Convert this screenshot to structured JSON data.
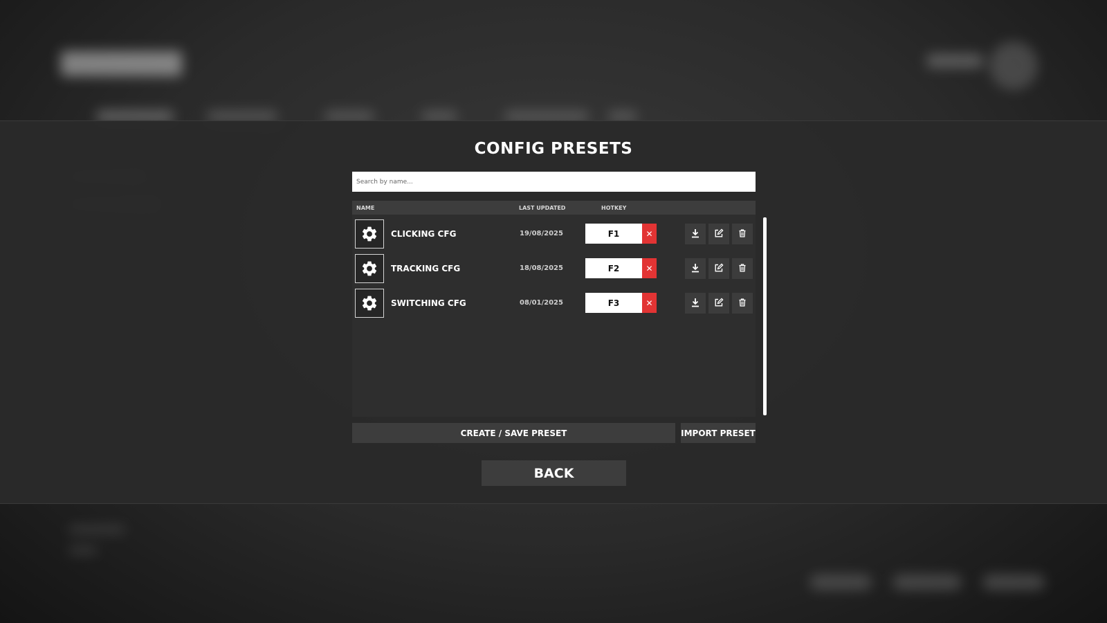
{
  "modal": {
    "title": "CONFIG PRESETS",
    "search_placeholder": "Search by name..."
  },
  "table": {
    "columns": {
      "name": "NAME",
      "last_updated": "LAST UPDATED",
      "hotkey": "HOTKEY"
    },
    "rows": [
      {
        "name": "CLICKING CFG",
        "last_updated": "19/08/2025",
        "hotkey": "F1",
        "icon": "gear-icon"
      },
      {
        "name": "TRACKING CFG",
        "last_updated": "18/08/2025",
        "hotkey": "F2",
        "icon": "gear-icon"
      },
      {
        "name": "SWITCHING CFG",
        "last_updated": "08/01/2025",
        "hotkey": "F3",
        "icon": "gear-icon"
      }
    ],
    "clear_hotkey_glyph": "✕"
  },
  "actions": {
    "create_save": "CREATE / SAVE PRESET",
    "import": "IMPORT PRESET",
    "back": "BACK"
  },
  "colors": {
    "clear_hotkey": "#e23434",
    "panel": "#2e2e2e",
    "button": "#3d3d3d"
  }
}
